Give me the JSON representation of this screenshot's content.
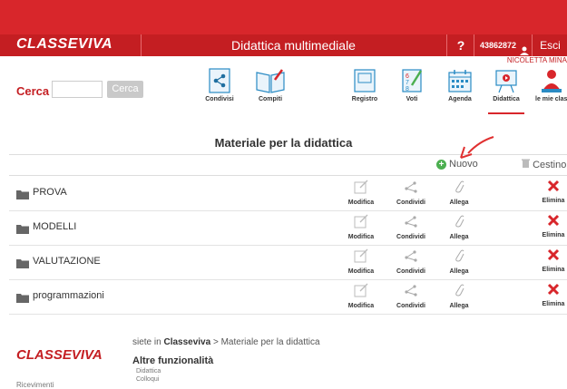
{
  "header": {
    "logo": "CLASSEVIVA",
    "title": "Didattica multimediale",
    "help": "?",
    "user_code": "43862872",
    "logout": "Esci",
    "username": "NICOLETTA MINA"
  },
  "search": {
    "label": "Cerca",
    "placeholder": "",
    "button": "Cerca"
  },
  "nav": [
    {
      "label": "Condivisi",
      "icon": "share-icon"
    },
    {
      "label": "Compiti",
      "icon": "book-icon"
    },
    {
      "label": "Registro",
      "icon": "register-icon"
    },
    {
      "label": "Voti",
      "icon": "grades-icon"
    },
    {
      "label": "Agenda",
      "icon": "calendar-icon"
    },
    {
      "label": "Didattica",
      "icon": "teaching-icon"
    },
    {
      "label": "le mie clas",
      "icon": "classes-icon"
    }
  ],
  "main": {
    "title": "Materiale per la didattica",
    "new_label": "Nuovo",
    "trash_label": "Cestino",
    "actions": {
      "edit": "Modifica",
      "share": "Condividi",
      "attach": "Allega",
      "delete": "Elimina"
    },
    "folders": [
      "PROVA",
      "MODELLI",
      "VALUTAZIONE",
      "programmazioni"
    ]
  },
  "footer": {
    "logo": "CLASSEVIVA",
    "breadcrumb_prefix": "siete in",
    "breadcrumb_app": "Classeviva",
    "breadcrumb_sep": ">",
    "breadcrumb_page": "Materiale per la didattica",
    "altre_title": "Altre funzionalità",
    "links": [
      "Didattica",
      "Colloqui"
    ],
    "cut_text": "Ricevimenti"
  },
  "colors": {
    "brand_red": "#c41e22",
    "accent_green": "#4caf50",
    "delete_red": "#d8262b"
  }
}
